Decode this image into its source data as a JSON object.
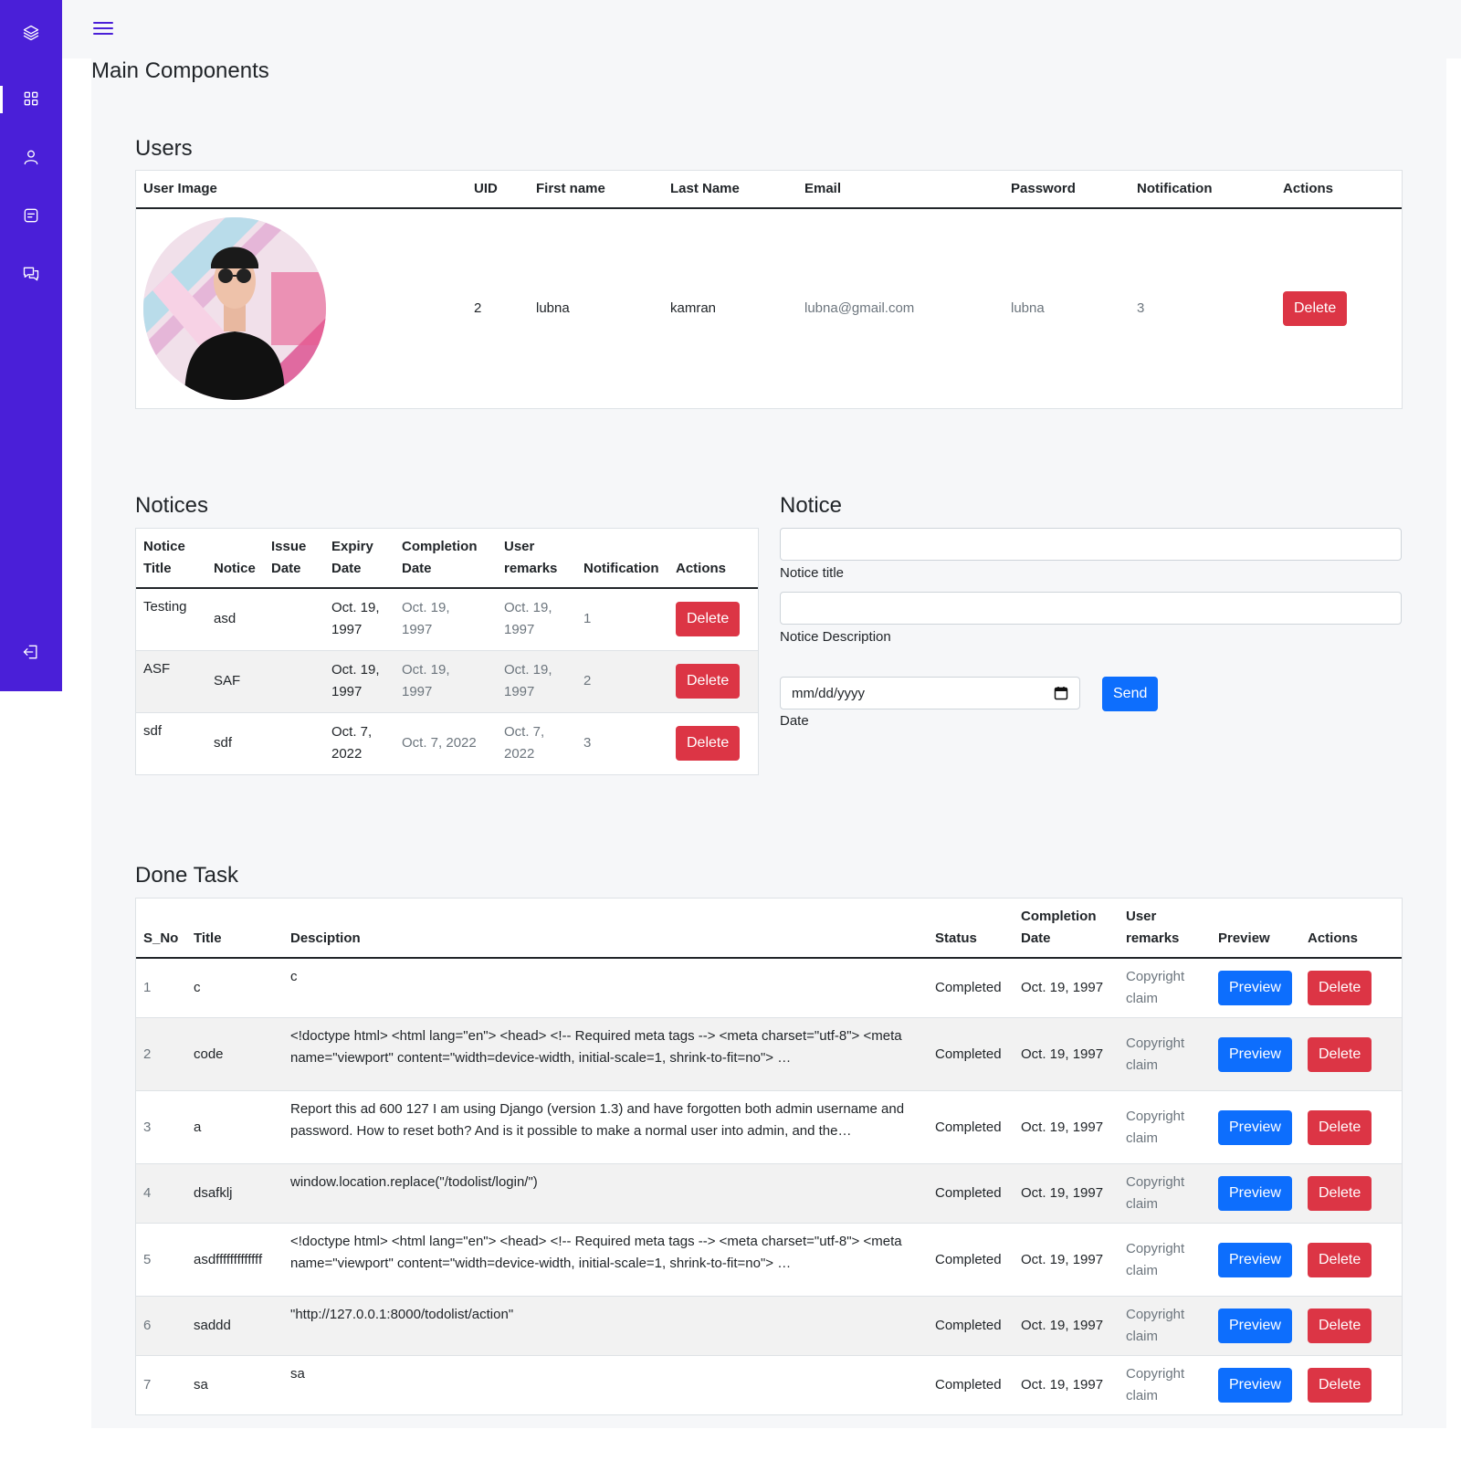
{
  "sidebar": {
    "items": [
      {
        "icon": "layers-icon"
      },
      {
        "icon": "dashboard-icon"
      },
      {
        "icon": "user-icon"
      },
      {
        "icon": "notes-icon"
      },
      {
        "icon": "chat-icon"
      },
      {
        "icon": "logout-icon"
      }
    ]
  },
  "page": {
    "title": "Main Components"
  },
  "users": {
    "title": "Users",
    "headers": [
      "User Image",
      "UID",
      "First name",
      "Last Name",
      "Email",
      "Password",
      "Notification",
      "Actions"
    ],
    "rows": [
      {
        "uid": "2",
        "first": "lubna",
        "last": "kamran",
        "email": "lubna@gmail.com",
        "password": "lubna",
        "notification": "3",
        "action": "Delete"
      }
    ]
  },
  "notices": {
    "title": "Notices",
    "headers": {
      "h0a": "Notice",
      "h0b": "Title",
      "h1": "Notice",
      "h2a": "Issue",
      "h2b": "Date",
      "h3a": "Expiry",
      "h3b": "Date",
      "h4a": "Completion",
      "h4b": "Date",
      "h5a": "User",
      "h5b": "remarks",
      "h6": "Notification",
      "h7": "Actions"
    },
    "rows": [
      {
        "title": "Testing",
        "notice": "asd",
        "issue": "",
        "expiry_a": "Oct. 19,",
        "expiry_b": "1997",
        "completion_a": "Oct. 19,",
        "completion_b": "1997",
        "remarks_a": "Oct. 19,",
        "remarks_b": "1997",
        "notification": "1",
        "action": "Delete"
      },
      {
        "title": "ASF",
        "notice": "SAF",
        "issue": "",
        "expiry_a": "Oct. 19,",
        "expiry_b": "1997",
        "completion_a": "Oct. 19,",
        "completion_b": "1997",
        "remarks_a": "Oct. 19,",
        "remarks_b": "1997",
        "notification": "2",
        "action": "Delete"
      },
      {
        "title": "sdf",
        "notice": "sdf",
        "issue": "",
        "expiry_a": "Oct. 7,",
        "expiry_b": "2022",
        "completion_a": "Oct. 7, 2022",
        "completion_b": "",
        "remarks_a": "Oct. 7,",
        "remarks_b": "2022",
        "notification": "3",
        "action": "Delete"
      }
    ]
  },
  "notice_form": {
    "title": "Notice",
    "title_label": "Notice title",
    "desc_label": "Notice Description",
    "date_placeholder": "mm/dd/yyyy",
    "date_label": "Date",
    "send": "Send"
  },
  "done": {
    "title": "Done Task",
    "headers": {
      "sno": "S_No",
      "title": "Title",
      "desc": "Desciption",
      "status": "Status",
      "comp_a": "Completion",
      "comp_b": "Date",
      "rem_a": "User",
      "rem_b": "remarks",
      "preview": "Preview",
      "actions": "Actions"
    },
    "rows": [
      {
        "sno": "1",
        "title": "c",
        "desc": "c",
        "status": "Completed",
        "date": "Oct. 19, 1997",
        "rem_a": "Copyright",
        "rem_b": "claim",
        "preview": "Preview",
        "action": "Delete"
      },
      {
        "sno": "2",
        "title": "code",
        "desc": "<!doctype html> <html lang=\"en\"> <head> <!-- Required meta tags --> <meta charset=\"utf-8\"> <meta name=\"viewport\" content=\"width=device-width, initial-scale=1, shrink-to-fit=no\"> …",
        "status": "Completed",
        "date": "Oct. 19, 1997",
        "rem_a": "Copyright",
        "rem_b": "claim",
        "preview": "Preview",
        "action": "Delete"
      },
      {
        "sno": "3",
        "title": "a",
        "desc": "Report this ad 600 127 I am using Django (version 1.3) and have forgotten both admin username and password. How to reset both? And is it possible to make a normal user into admin, and the…",
        "status": "Completed",
        "date": "Oct. 19, 1997",
        "rem_a": "Copyright",
        "rem_b": "claim",
        "preview": "Preview",
        "action": "Delete"
      },
      {
        "sno": "4",
        "title": "dsafklj",
        "desc": "window.location.replace(\"/todolist/login/\")",
        "status": "Completed",
        "date": "Oct. 19, 1997",
        "rem_a": "Copyright",
        "rem_b": "claim",
        "preview": "Preview",
        "action": "Delete"
      },
      {
        "sno": "5",
        "title": "asdfffffffffffff",
        "desc": "<!doctype html> <html lang=\"en\"> <head> <!-- Required meta tags --> <meta charset=\"utf-8\"> <meta name=\"viewport\" content=\"width=device-width, initial-scale=1, shrink-to-fit=no\"> …",
        "status": "Completed",
        "date": "Oct. 19, 1997",
        "rem_a": "Copyright",
        "rem_b": "claim",
        "preview": "Preview",
        "action": "Delete"
      },
      {
        "sno": "6",
        "title": "saddd",
        "desc": "\"http://127.0.0.1:8000/todolist/action\"",
        "status": "Completed",
        "date": "Oct. 19, 1997",
        "rem_a": "Copyright",
        "rem_b": "claim",
        "preview": "Preview",
        "action": "Delete"
      },
      {
        "sno": "7",
        "title": "sa",
        "desc": "sa",
        "status": "Completed",
        "date": "Oct. 19, 1997",
        "rem_a": "Copyright",
        "rem_b": "claim",
        "preview": "Preview",
        "action": "Delete"
      }
    ]
  },
  "colors": {
    "sidebar": "#4a1fd8",
    "danger": "#dc3545",
    "primary": "#0d6efd",
    "background": "#f6f7f9"
  }
}
